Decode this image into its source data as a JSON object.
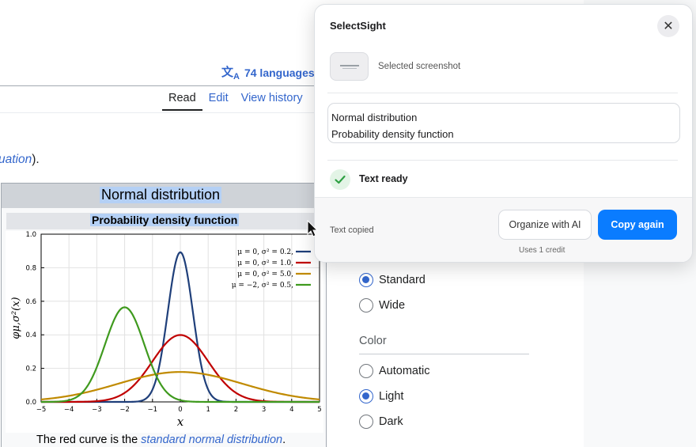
{
  "article": {
    "languages_label": "74 languages",
    "languages_glyph": "文A",
    "tabs": [
      {
        "label": "Read",
        "active": true
      },
      {
        "label": "Edit",
        "active": false
      },
      {
        "label": "View history",
        "active": false
      }
    ],
    "partial_text_link": "uation",
    "partial_text_tail": ").",
    "infobox": {
      "title": "Normal distribution",
      "subtitle": "Probability density function",
      "caption_prefix": "The red curve is the ",
      "caption_link": "standard normal distribution",
      "caption_suffix": "."
    }
  },
  "settings": {
    "width_options": [
      {
        "label": "Standard",
        "selected": true
      },
      {
        "label": "Wide",
        "selected": false
      }
    ],
    "color_heading": "Color",
    "color_options": [
      {
        "label": "Automatic",
        "selected": false
      },
      {
        "label": "Light",
        "selected": true
      },
      {
        "label": "Dark",
        "selected": false
      }
    ]
  },
  "popup": {
    "title": "SelectSight",
    "close_icon": "close-icon",
    "screenshot_label": "Selected screenshot",
    "extracted_lines": [
      "Normal distribution",
      "Probability density function"
    ],
    "status": "Text ready",
    "footer_status": "Text copied",
    "organize_label": "Organize with AI",
    "credit_note": "Uses 1 credit",
    "copy_label": "Copy again",
    "accent": "#0a7cff",
    "success": "#2ea043"
  },
  "chart_data": {
    "type": "line",
    "xlabel": "x",
    "ylabel": "φμ,σ²(x)",
    "xlim": [
      -5,
      5
    ],
    "ylim": [
      0,
      1.0
    ],
    "xticks": [
      -5,
      -4,
      -3,
      -2,
      -1,
      0,
      1,
      2,
      3,
      4,
      5
    ],
    "xtick_labels": [
      "−5",
      "−4",
      "−3",
      "−2",
      "−1",
      "0",
      "1",
      "2",
      "3",
      "4",
      "5"
    ],
    "yticks": [
      0.0,
      0.2,
      0.4,
      0.6,
      0.8,
      1.0
    ],
    "ytick_labels": [
      "0.0",
      "0.2",
      "0.4",
      "0.6",
      "0.8",
      "1.0"
    ],
    "legend_position": "top-right",
    "series": [
      {
        "name": "μ = 0, σ² = 0.2,",
        "mu": 0,
        "variance": 0.2,
        "color": "#1f3f7a"
      },
      {
        "name": "μ = 0, σ² = 1.0,",
        "mu": 0,
        "variance": 1.0,
        "color": "#c00000"
      },
      {
        "name": "μ = 0, σ² = 5.0,",
        "mu": 0,
        "variance": 5.0,
        "color": "#c08a00"
      },
      {
        "name": "μ = −2, σ² = 0.5,",
        "mu": -2,
        "variance": 0.5,
        "color": "#3f9a1e"
      }
    ]
  }
}
